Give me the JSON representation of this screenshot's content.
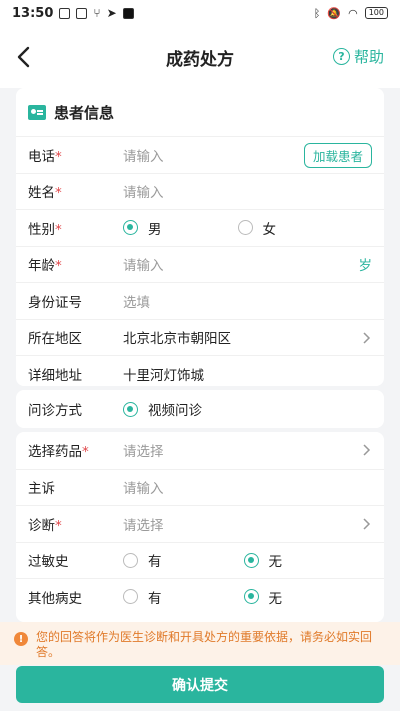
{
  "status": {
    "time": "13:50",
    "battery": "100"
  },
  "nav": {
    "title": "成药处方",
    "help": "帮助"
  },
  "patient": {
    "title": "患者信息",
    "phone": {
      "label": "电话",
      "required": "*",
      "placeholder": "请输入",
      "load_btn": "加载患者"
    },
    "name": {
      "label": "姓名",
      "required": "*",
      "placeholder": "请输入"
    },
    "gender": {
      "label": "性别",
      "required": "*",
      "options": [
        "男",
        "女"
      ],
      "selected": "男"
    },
    "age": {
      "label": "年龄",
      "required": "*",
      "placeholder": "请输入",
      "unit": "岁"
    },
    "idcard": {
      "label": "身份证号",
      "placeholder": "选填"
    },
    "region": {
      "label": "所在地区",
      "value": "北京北京市朝阳区"
    },
    "address": {
      "label": "详细地址",
      "value": "十里河灯饰城"
    }
  },
  "consult": {
    "label": "问诊方式",
    "option": "视频问诊"
  },
  "medical": {
    "drugs": {
      "label": "选择药品",
      "required": "*",
      "placeholder": "请选择"
    },
    "complaint": {
      "label": "主诉",
      "placeholder": "请输入"
    },
    "diagnosis": {
      "label": "诊断",
      "required": "*",
      "placeholder": "请选择"
    },
    "allergy": {
      "label": "过敏史",
      "options": [
        "有",
        "无"
      ],
      "selected": "无"
    },
    "other_history": {
      "label": "其他病史",
      "options": [
        "有",
        "无"
      ],
      "selected": "无"
    }
  },
  "notice": {
    "text": "您的回答将作为医生诊断和开具处方的重要依据，请务必如实回答。"
  },
  "submit": {
    "label": "确认提交"
  },
  "colors": {
    "accent": "#2ab59e",
    "warning": "#e07a2a",
    "required": "#e0474a"
  }
}
